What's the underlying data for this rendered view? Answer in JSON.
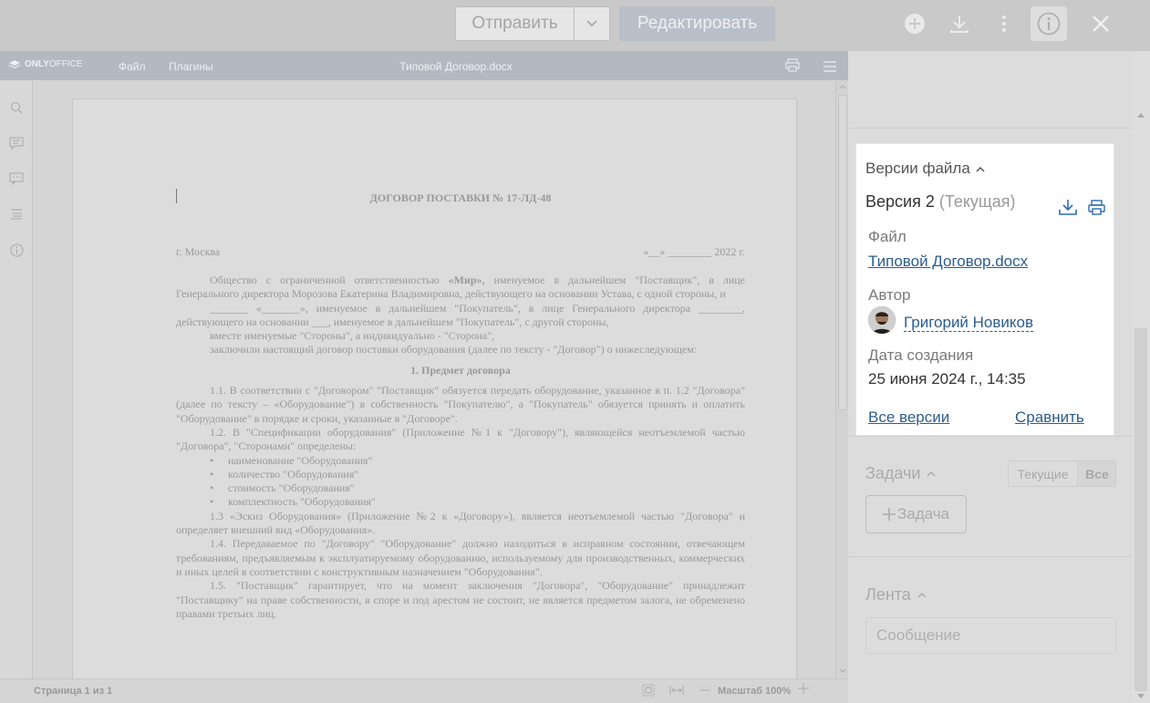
{
  "toolbar": {
    "send_label": "Отправить",
    "edit_label": "Редактировать"
  },
  "editor": {
    "logo_bold": "ONLY",
    "logo_light": "OFFICE",
    "menu_file": "Файл",
    "menu_plugins": "Плагины",
    "doc_title": "Типовой Договор.docx",
    "status_page": "Страница 1 из 1",
    "zoom_label": "Масштаб 100%"
  },
  "document": {
    "title": "ДОГОВОР ПОСТАВКИ № 17-ЛД-48",
    "city": "г. Москва",
    "date": "«__» ________ 2022 г.",
    "p1_a": "Общество с ограниченной ответственностью ",
    "p1_b": "«Мир»,",
    "p1_c": " именуемое в дальнейшем \"Поставщик\", в лице Генерального директора Морозова Екатерина Владимировна, действующего на основании Устава, с одной стороны, и",
    "p2": "_______ «_______», именуемое в дальнейшем \"Покупатель\", в лице Генерального директора ________, действующего на основании ___, именуемое в дальнейшем \"Покупатель\", с другой стороны,",
    "p3": "вместе именуемые \"Стороны\", а индивидуально - \"Сторона\",",
    "p4": "заключили настоящий договор поставки оборудования (далее по тексту - \"Договор\") о нижеследующем:",
    "section1": "1. Предмет договора",
    "p5": "1.1. В соответствии с \"Договором\" \"Поставщик\" обязуется передать оборудование, указанное в п. 1.2 \"Договора\" (далее по тексту – «Оборудование\") в собственность \"Покупателю\", а \"Покупатель\" обязуется принять и оплатить \"Оборудование\" в порядке и сроки, указанные в \"Договоре\".",
    "p6": "1.2. В \"Спецификации оборудования\" (Приложение №1 к \"Договору\"), являющейся неотъемлемой частью \"Договора\", \"Сторонами\" определены:",
    "bullets": [
      "наименование \"Оборудования\"",
      "количество \"Оборудования\"",
      "стоимость \"Оборудования\"",
      "комплектность \"Оборудования\""
    ],
    "p7": "1.3 «Эскиз Оборудования» (Приложение №2 к «Договору»), является неотъемлемой частью \"Договора\" и определяет внешний вид «Оборудования».",
    "p8": "1.4. Передаваемое по \"Договору\" \"Оборудование\" должно находиться в исправном состоянии, отвечающем требованиям, предъявляемым к эксплуатируемому оборудованию, используемому для производственных, коммерческих и иных целей в соответствии с конструктивным назначением \"Оборудования\".",
    "p9": "1.5. \"Поставщик\" гарантирует, что на момент заключения \"Договора\", \"Оборудование\" принадлежит \"Поставщику\" на праве собственности, в споре и под арестом не состоит, не является предметом залога, не обременено правами третьих лиц."
  },
  "versions": {
    "header": "Версии файла",
    "version_label": "Версия 2",
    "version_status": "(Текущая)",
    "file_label": "Файл",
    "file_name": "Типовой Договор.docx",
    "author_label": "Автор",
    "author_name": "Григорий Новиков",
    "created_label": "Дата создания",
    "created_value": "25 июня 2024 г., 14:35",
    "all_versions": "Все версии",
    "compare": "Сравнить"
  },
  "tasks": {
    "header": "Задачи",
    "filter_current": "Текущие",
    "filter_all": "Все",
    "add_task": "Задача"
  },
  "feed": {
    "header": "Лента",
    "message_placeholder": "Сообщение"
  }
}
